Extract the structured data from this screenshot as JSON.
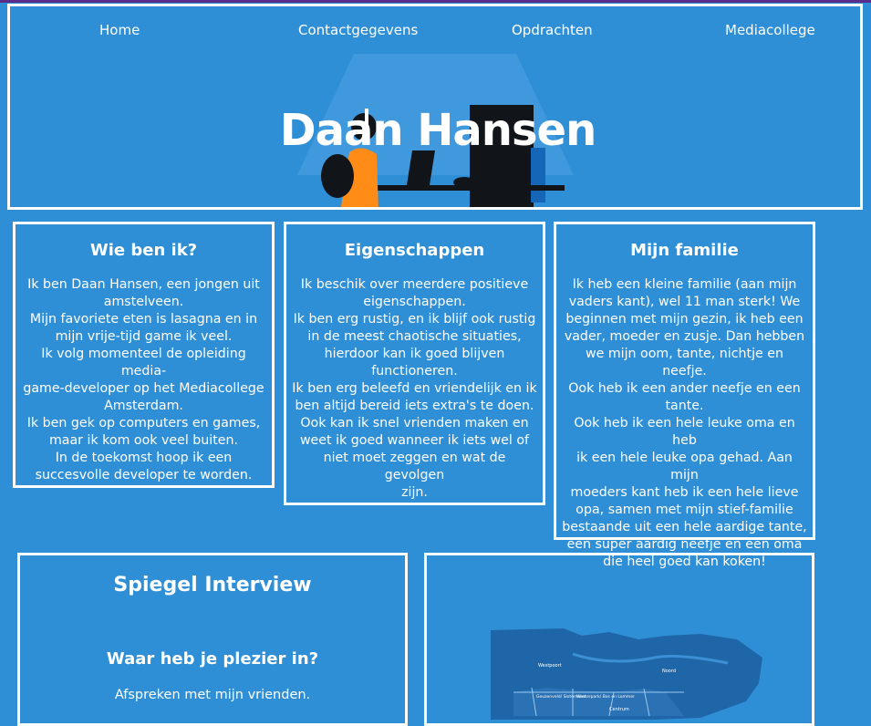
{
  "nav": {
    "items": [
      {
        "label": "Home"
      },
      {
        "label": "Contactgegevens"
      },
      {
        "label": "Opdrachten"
      },
      {
        "label": "Mediacollege"
      }
    ]
  },
  "hero": {
    "title": "Daan Hansen"
  },
  "cards": [
    {
      "heading": "Wie ben ik?",
      "lines": [
        "Ik ben Daan Hansen, een jongen uit",
        "amstelveen.",
        "Mijn favoriete eten is lasagna en in",
        "mijn vrije-tijd game ik veel.",
        "Ik volg momenteel de opleiding media-",
        "game-developer op het Mediacollege",
        "Amsterdam.",
        "Ik ben gek op computers en games,",
        "maar ik kom ook veel buiten.",
        "In de toekomst hoop ik een",
        "succesvolle developer te worden."
      ]
    },
    {
      "heading": "Eigenschappen",
      "lines": [
        "Ik beschik over meerdere positieve",
        "eigenschappen.",
        "Ik ben erg rustig, en ik blijf ook rustig",
        "in de meest chaotische situaties,",
        "hierdoor kan ik goed blijven",
        "functioneren.",
        "Ik ben erg beleefd en vriendelijk en ik",
        "ben altijd bereid iets extra's te doen.",
        "Ook kan ik snel vrienden maken en",
        "weet ik goed wanneer ik iets wel of",
        "niet moet zeggen en wat de gevolgen",
        "zijn."
      ]
    },
    {
      "heading": "Mijn familie",
      "lines": [
        "Ik heb een kleine familie (aan mijn",
        "vaders kant), wel 11 man sterk! We",
        "beginnen met mijn gezin, ik heb een",
        "vader, moeder en zusje. Dan hebben",
        "we mijn oom, tante, nichtje en neefje.",
        "Ook heb ik een ander neefje en een",
        "tante.",
        "Ook heb ik een hele leuke oma en heb",
        "ik een hele leuke opa gehad. Aan mijn",
        "moeders kant heb ik een hele lieve",
        "opa, samen met mijn stief-familie",
        "bestaande uit een hele aardige tante,",
        "een super aardig neefje en een oma",
        "die heel goed kan koken!"
      ]
    }
  ],
  "interview": {
    "title": "Spiegel Interview",
    "question": "Waar heb je plezier in?",
    "answer": "Afspreken met mijn vrienden."
  },
  "map": {
    "labels": [
      "Westpoort",
      "Noord",
      "Geuzenveld/ Slotermeer",
      "Westerpark/ Bos en Lommer",
      "Centrum"
    ]
  }
}
